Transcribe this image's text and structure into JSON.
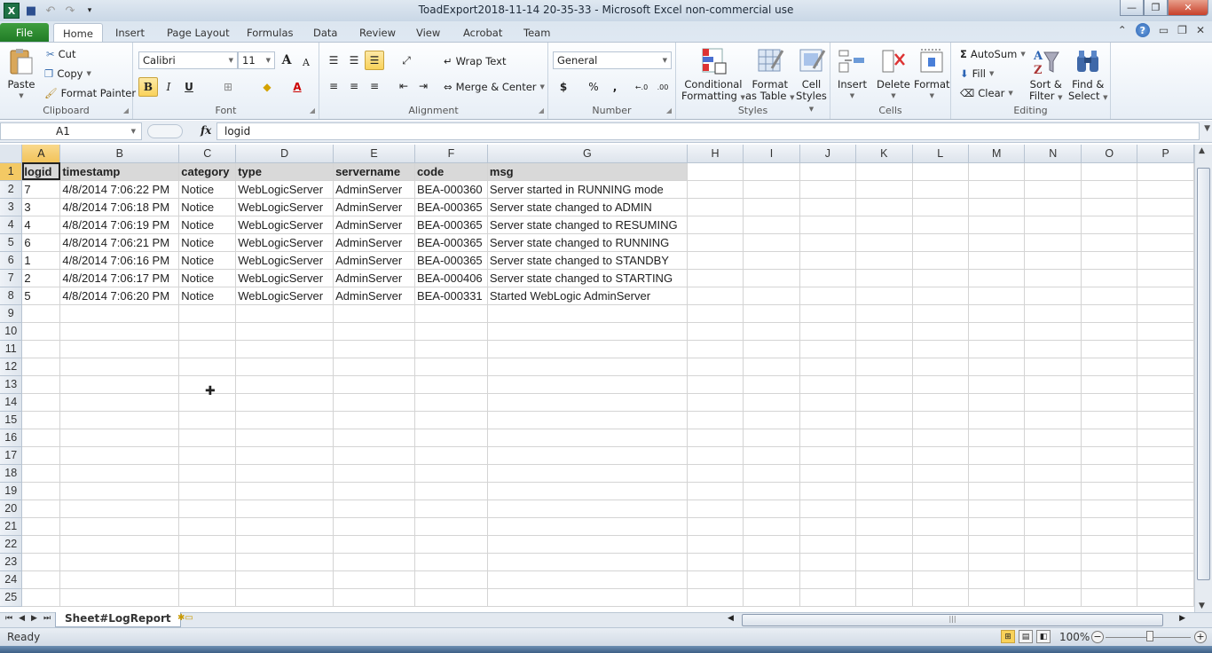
{
  "window": {
    "title": "ToadExport2018-11-14 20-35-33  -  Microsoft Excel non-commercial use",
    "app_icon": "excel-icon",
    "quick_access": [
      "save-icon",
      "undo-icon",
      "redo-icon",
      "customize-qat-icon"
    ],
    "controls": {
      "minimize": "—",
      "restore": "❐",
      "close": "✕"
    }
  },
  "ribbon_tabs": [
    "File",
    "Home",
    "Insert",
    "Page Layout",
    "Formulas",
    "Data",
    "Review",
    "View",
    "Acrobat",
    "Team"
  ],
  "active_tab": "Home",
  "ribbon": {
    "clipboard": {
      "label": "Clipboard",
      "paste": "Paste",
      "cut": "Cut",
      "copy": "Copy",
      "format_painter": "Format Painter"
    },
    "font": {
      "label": "Font",
      "font_name": "Calibri",
      "font_size": "11",
      "bold": "B",
      "italic": "I",
      "underline": "U",
      "grow": "A",
      "shrink": "A"
    },
    "alignment": {
      "label": "Alignment",
      "wrap_text": "Wrap Text",
      "merge_center": "Merge & Center"
    },
    "number": {
      "label": "Number",
      "format": "General",
      "currency": "$",
      "percent": "%",
      "comma": ",",
      "inc_decimal": "←.0",
      "dec_decimal": ".00"
    },
    "styles": {
      "label": "Styles",
      "conditional_formatting": [
        "Conditional",
        "Formatting"
      ],
      "format_as_table": [
        "Format",
        "as Table"
      ],
      "cell_styles": [
        "Cell",
        "Styles"
      ]
    },
    "cells": {
      "label": "Cells",
      "insert": "Insert",
      "delete": "Delete",
      "format": "Format"
    },
    "editing": {
      "label": "Editing",
      "autosum": "AutoSum",
      "fill": "Fill",
      "clear": "Clear",
      "sort_filter": [
        "Sort &",
        "Filter"
      ],
      "find_select": [
        "Find &",
        "Select"
      ]
    }
  },
  "formula_bar": {
    "name_box": "A1",
    "fx": "fx",
    "formula": "logid"
  },
  "columns": [
    "A",
    "B",
    "C",
    "D",
    "E",
    "F",
    "G",
    "H",
    "I",
    "J",
    "K",
    "L",
    "M",
    "N",
    "O",
    "P"
  ],
  "sheet": {
    "headers": [
      "logid",
      "timestamp",
      "category",
      "type",
      "servername",
      "code",
      "msg"
    ],
    "rows": [
      [
        "7",
        "4/8/2014 7:06:22 PM",
        "Notice",
        "WebLogicServer",
        "AdminServer",
        "BEA-000360",
        "Server started in RUNNING mode"
      ],
      [
        "3",
        "4/8/2014 7:06:18 PM",
        "Notice",
        "WebLogicServer",
        "AdminServer",
        "BEA-000365",
        "Server state changed to ADMIN"
      ],
      [
        "4",
        "4/8/2014 7:06:19 PM",
        "Notice",
        "WebLogicServer",
        "AdminServer",
        "BEA-000365",
        "Server state changed to RESUMING"
      ],
      [
        "6",
        "4/8/2014 7:06:21 PM",
        "Notice",
        "WebLogicServer",
        "AdminServer",
        "BEA-000365",
        "Server state changed to RUNNING"
      ],
      [
        "1",
        "4/8/2014 7:06:16 PM",
        "Notice",
        "WebLogicServer",
        "AdminServer",
        "BEA-000365",
        "Server state changed to STANDBY"
      ],
      [
        "2",
        "4/8/2014 7:06:17 PM",
        "Notice",
        "WebLogicServer",
        "AdminServer",
        "BEA-000406",
        "Server state changed to STARTING"
      ],
      [
        "5",
        "4/8/2014 7:06:20 PM",
        "Notice",
        "WebLogicServer",
        "AdminServer",
        "BEA-000331",
        "Started WebLogic AdminServer"
      ]
    ],
    "visible_row_count": 25
  },
  "sheet_tabs": [
    "Sheet#LogReport"
  ],
  "status": {
    "text": "Ready",
    "zoom": "100%"
  },
  "colors": {
    "file_tab": "#1f7a25",
    "selected_header": "#f2c35a",
    "header_row_fill": "#d9d9d9"
  }
}
